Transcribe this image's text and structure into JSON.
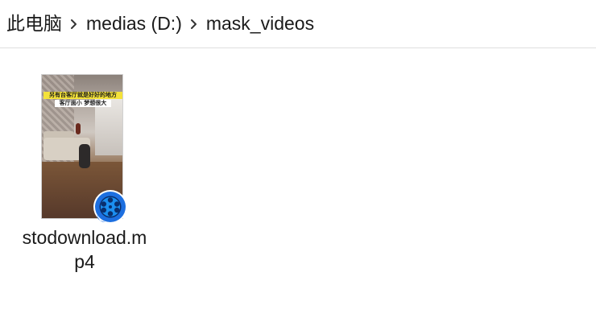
{
  "breadcrumb": {
    "items": [
      {
        "label": "此电脑"
      },
      {
        "label": "medias (D:)"
      },
      {
        "label": "mask_videos"
      }
    ]
  },
  "files": [
    {
      "name_line1": "stodownload.m",
      "name_line2": "p4",
      "thumbnail_caption_line1": "另有台客厅就是好好的地方",
      "thumbnail_caption_line2": "客厅面小 梦想很大",
      "app_badge_icon": "media-player-reel-icon",
      "badge_color": "#1d6fe0"
    }
  ]
}
